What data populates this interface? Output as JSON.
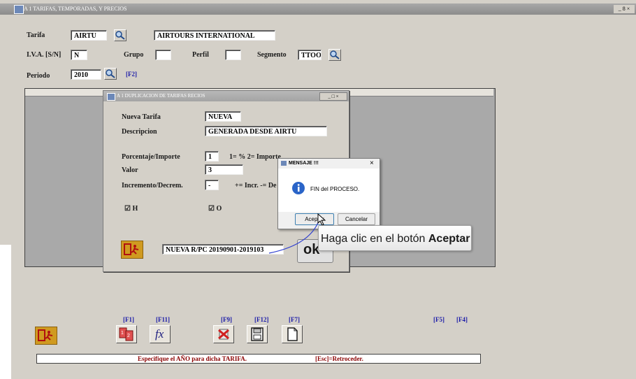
{
  "window": {
    "title": "A 1  TARIFAS, TEMPORADAS, Y PRECIOS",
    "controls": "_ 8 ×"
  },
  "form": {
    "tarifa_label": "Tarifa",
    "tarifa_code": "AIRTU",
    "tarifa_name": "AIRTOURS INTERNATIONAL",
    "iva_label": "I.V.A. [S/N]",
    "iva_value": "N",
    "grupo_label": "Grupo",
    "grupo_value": "",
    "perfil_label": "Perfil",
    "perfil_value": "",
    "segmento_label": "Segmento",
    "segmento_value": "TTOO",
    "periodo_label": "Periodo",
    "periodo_value": "2010",
    "periodo_fkey": "[F2]"
  },
  "dialog": {
    "title": "A 1  DUPLICACION DE TARIFAS  RECIOS",
    "nueva_tarifa_label": "Nueva Tarifa",
    "nueva_tarifa_value": "NUEVA",
    "descripcion_label": "Descripcion",
    "descripcion_value": "GENERADA DESDE AIRTU",
    "porcentaje_label": "Porcentaje/Importe",
    "porcentaje_value": "1",
    "porcentaje_hint": "1= %   2= Importe",
    "valor_label": "Valor",
    "valor_value": "3",
    "incremento_label": "Incremento/Decrem.",
    "incremento_value": "-",
    "incremento_hint": "+= Incr.  -= De",
    "check_h": "☑ H",
    "check_o": "☑ O",
    "result_value": "NUEVA R/PC  20190901-2019103",
    "ok_label": "ok"
  },
  "message": {
    "title": "MENSAJE !!!",
    "text": "FIN del PROCESO.",
    "accept": "Aceptar",
    "cancel": "Cancelar",
    "close": "×"
  },
  "callout": {
    "text_prefix": "Haga clic en el botón ",
    "text_bold": "Aceptar"
  },
  "toolbar": {
    "f1": "[F1]",
    "f11": "[F11]",
    "f9": "[F9]",
    "f12": "[F12]",
    "f7": "[F7]",
    "f5": "[F5]",
    "f4": "[F4]",
    "fx": "fx"
  },
  "status": {
    "message": "Especifique el AÑO para dicha TARIFA.",
    "esc_hint": "[Esc]=Retroceder."
  },
  "colors": {
    "window_bg": "#d4d0c8",
    "fkey_blue": "#1a1aa8",
    "status_red": "#8b0000",
    "exit_orange": "#d09a20"
  }
}
